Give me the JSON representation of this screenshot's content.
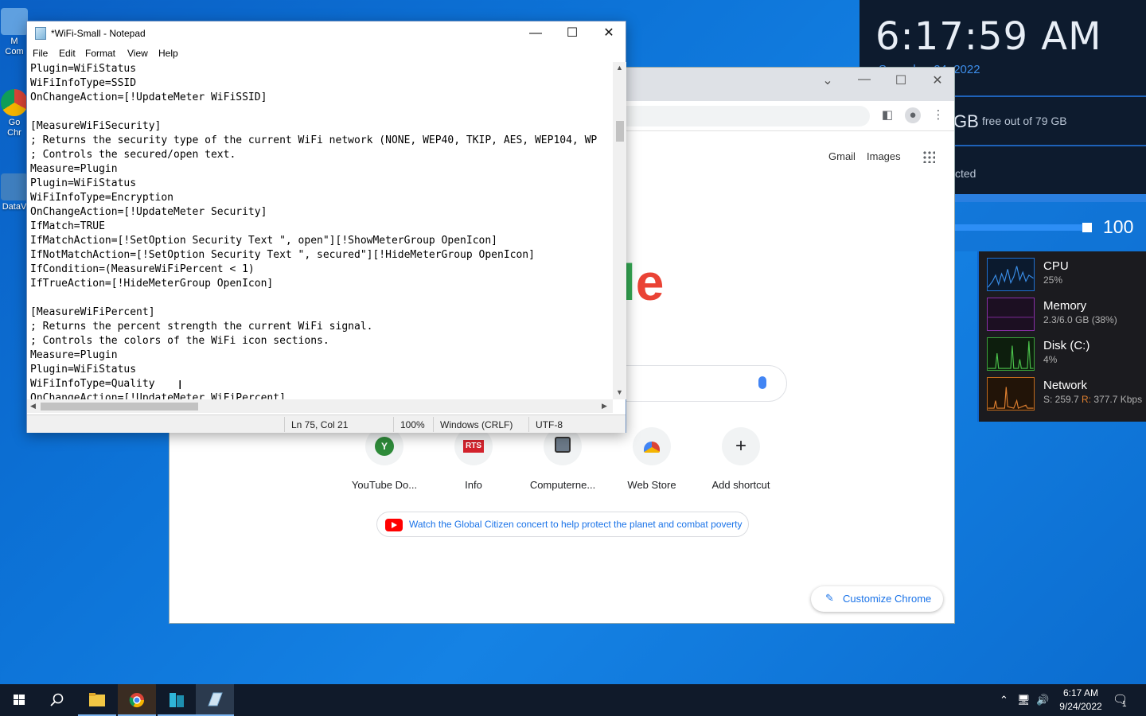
{
  "desktop": {
    "icons": [
      {
        "label": "M\nCom",
        "name": "computer-icon"
      },
      {
        "label": "Go\nChr",
        "name": "chrome-icon"
      },
      {
        "label": "DataV",
        "name": "datav-icon"
      }
    ]
  },
  "rainmeter": {
    "time": "6:17:59 AM",
    "date": "S...ember 24, 2022",
    "disk_big": "GB",
    "disk_text": "free out of 79 GB",
    "net_text": "cted",
    "volume": "100",
    "volume_level": 0.93
  },
  "taskmgr": {
    "items": [
      {
        "name": "CPU",
        "value": "25%",
        "color": "#1f6fd0"
      },
      {
        "name": "Memory",
        "value": "2.3/6.0 GB (38%)",
        "color": "#8a2fa8"
      },
      {
        "name": "Disk (C:)",
        "value": "4%",
        "color": "#3aa33a"
      },
      {
        "name": "Network",
        "value_prefix": "S: 259.7 ",
        "value_r": "R:",
        "value_suffix": " 377.7 Kbps",
        "color": "#c06a1c"
      }
    ]
  },
  "chrome": {
    "links": {
      "gmail": "Gmail",
      "images": "Images"
    },
    "logo_fragment": "le",
    "shortcuts": [
      {
        "label": "YouTube Do...",
        "badge": "Y"
      },
      {
        "label": "Info",
        "badge": "RTS"
      },
      {
        "label": "Computerne...",
        "badge": ""
      },
      {
        "label": "Web Store",
        "badge": ""
      },
      {
        "label": "Add shortcut",
        "badge": "+"
      }
    ],
    "promo": "Watch the Global Citizen concert to help protect the planet and combat poverty",
    "customize": "Customize Chrome"
  },
  "notepad": {
    "title": "*WiFi-Small - Notepad",
    "menus": [
      "File",
      "Edit",
      "Format",
      "View",
      "Help"
    ],
    "lines": [
      "Plugin=WiFiStatus",
      "WiFiInfoType=SSID",
      "OnChangeAction=[!UpdateMeter WiFiSSID]",
      "",
      "[MeasureWiFiSecurity]",
      "; Returns the security type of the current WiFi network (NONE, WEP40, TKIP, AES, WEP104, WP",
      "; Controls the secured/open text.",
      "Measure=Plugin",
      "Plugin=WiFiStatus",
      "WiFiInfoType=Encryption",
      "OnChangeAction=[!UpdateMeter Security]",
      "IfMatch=TRUE",
      "IfMatchAction=[!SetOption Security Text \", open\"][!ShowMeterGroup OpenIcon]",
      "IfNotMatchAction=[!SetOption Security Text \", secured\"][!HideMeterGroup OpenIcon]",
      "IfCondition=(MeasureWiFiPercent < 1)",
      "IfTrueAction=[!HideMeterGroup OpenIcon]",
      "",
      "[MeasureWiFiPercent]",
      "; Returns the percent strength the current WiFi signal.",
      "; Controls the colors of the WiFi icon sections.",
      "Measure=Plugin",
      "Plugin=WiFiStatus",
      "WiFiInfoType=Quality",
      "OnChangeAction=[!UpdateMeter WiFiPercent]"
    ],
    "status": {
      "position": "Ln 75, Col 21",
      "zoom": "100%",
      "line_endings": "Windows (CRLF)",
      "encoding": "UTF-8"
    }
  },
  "taskbar": {
    "time": "6:17 AM",
    "date": "9/24/2022",
    "notifications": "1"
  }
}
